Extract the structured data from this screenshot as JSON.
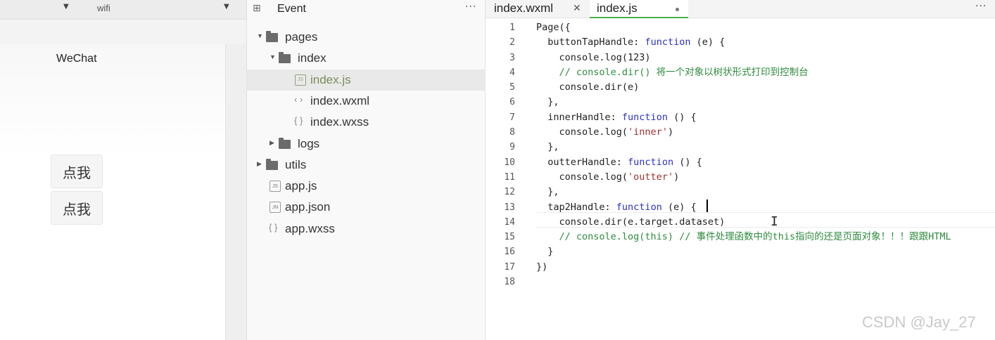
{
  "simulator": {
    "network": "wifi",
    "nav_title": "WeChat",
    "buttons": [
      "点我",
      "点我"
    ]
  },
  "explorer": {
    "title": "Event",
    "more_label": "···",
    "tree": [
      {
        "label": "pages",
        "kind": "folder",
        "expanded": true,
        "depth": 0
      },
      {
        "label": "index",
        "kind": "folder",
        "expanded": true,
        "depth": 1
      },
      {
        "label": "index.js",
        "kind": "js",
        "depth": 2,
        "selected": true
      },
      {
        "label": "index.wxml",
        "kind": "wxml",
        "depth": 2
      },
      {
        "label": "index.wxss",
        "kind": "wxss",
        "depth": 2
      },
      {
        "label": "logs",
        "kind": "folder",
        "expanded": false,
        "depth": 1
      },
      {
        "label": "utils",
        "kind": "folder",
        "expanded": false,
        "depth": 0
      },
      {
        "label": "app.js",
        "kind": "js",
        "depth": 0
      },
      {
        "label": "app.json",
        "kind": "json",
        "depth": 0
      },
      {
        "label": "app.wxss",
        "kind": "wxss",
        "depth": 0
      }
    ]
  },
  "editor": {
    "tabs": [
      {
        "label": "index.wxml",
        "active": false
      },
      {
        "label": "index.js",
        "active": true,
        "modified": true
      }
    ],
    "more_label": "···",
    "line_numbers": [
      "1",
      "2",
      "3",
      "4",
      "5",
      "6",
      "7",
      "8",
      "9",
      "10",
      "11",
      "12",
      "13",
      "14",
      "15",
      "16",
      "17",
      "18"
    ],
    "lines": [
      [
        {
          "t": "Page({"
        }
      ],
      [
        {
          "t": "  buttonTapHandle: "
        },
        {
          "t": "function",
          "c": "kw"
        },
        {
          "t": " (e) {"
        }
      ],
      [
        {
          "t": "    console.log(123)"
        }
      ],
      [
        {
          "t": "    // console.dir() 将一个对象以树状形式打印到控制台",
          "c": "cm"
        }
      ],
      [
        {
          "t": "    console.dir(e)"
        }
      ],
      [
        {
          "t": "  },"
        }
      ],
      [
        {
          "t": "  innerHandle: "
        },
        {
          "t": "function",
          "c": "kw"
        },
        {
          "t": " () {"
        }
      ],
      [
        {
          "t": "    console.log("
        },
        {
          "t": "'inner'",
          "c": "str"
        },
        {
          "t": ")"
        }
      ],
      [
        {
          "t": "  },"
        }
      ],
      [
        {
          "t": "  outterHandle: "
        },
        {
          "t": "function",
          "c": "kw"
        },
        {
          "t": " () {"
        }
      ],
      [
        {
          "t": "    console.log("
        },
        {
          "t": "'outter'",
          "c": "str"
        },
        {
          "t": ")"
        }
      ],
      [
        {
          "t": "  },"
        }
      ],
      [
        {
          "t": "  tap2Handle: "
        },
        {
          "t": "function",
          "c": "kw"
        },
        {
          "t": " (e) {"
        }
      ],
      [
        {
          "t": "    console.dir(e.target.dataset)"
        }
      ],
      [
        {
          "t": "    // console.log(this) // 事件处理函数中的this指向的还是页面对象！！！跟跟HTML",
          "c": "cm"
        }
      ],
      [
        {
          "t": "  }"
        }
      ],
      [
        {
          "t": "})"
        }
      ],
      [
        {
          "t": ""
        }
      ]
    ]
  },
  "watermark": "CSDN @Jay_27",
  "colors": {
    "active_tab_underline": "#4caf50",
    "keyword": "#2b31c4",
    "string": "#a03030",
    "comment": "#2e8b3f"
  }
}
